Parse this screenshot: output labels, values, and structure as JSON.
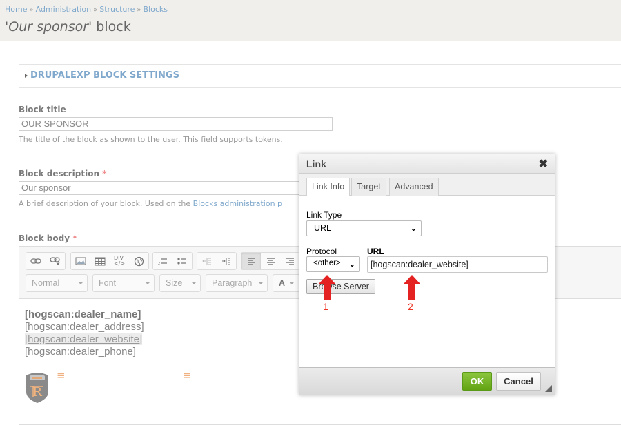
{
  "breadcrumb": [
    {
      "label": "Home"
    },
    {
      "label": "Administration"
    },
    {
      "label": "Structure"
    },
    {
      "label": "Blocks"
    }
  ],
  "breadcrumb_separator": "»",
  "page_title": {
    "prefix": "'",
    "name": "Our sponsor",
    "suffix": "' block"
  },
  "fieldset": {
    "legend": "DRUPALEXP BLOCK SETTINGS"
  },
  "block_title": {
    "label": "Block title",
    "value": "OUR SPONSOR",
    "description": "The title of the block as shown to the user. This field supports tokens."
  },
  "block_description": {
    "label": "Block description",
    "required_marker": "*",
    "value": "Our sponsor",
    "description_prefix": "A brief description of your block. Used on the ",
    "description_link": "Blocks administration p"
  },
  "block_body": {
    "label": "Block body",
    "required_marker": "*",
    "toolbar": {
      "groups": [
        [
          "link-icon",
          "unlink-icon"
        ],
        [
          "image-icon",
          "table-icon",
          "div-icon",
          "iframe-globe-icon"
        ],
        [
          "numbered-list-icon",
          "bulleted-list-icon"
        ],
        [
          "outdent-icon",
          "indent-icon"
        ],
        [
          "align-left-icon",
          "align-center-icon",
          "align-right-icon"
        ]
      ],
      "combos": [
        "Normal",
        "Font",
        "Size",
        "Paragraph"
      ],
      "text_color_label": "A"
    },
    "content": {
      "line1": "[hogscan:dealer_name]",
      "line2": "[hogscan:dealer_address]",
      "line3": "[hogscan:dealer_website]",
      "line4": "[hogscan:dealer_phone]"
    }
  },
  "dialog": {
    "title": "Link",
    "close_glyph": "✖",
    "tabs": [
      {
        "label": "Link Info",
        "active": true
      },
      {
        "label": "Target",
        "active": false
      },
      {
        "label": "Advanced",
        "active": false
      }
    ],
    "link_type_label": "Link Type",
    "link_type_value": "URL",
    "protocol_label": "Protocol",
    "protocol_value": "<other>",
    "url_label": "URL",
    "url_value": "[hogscan:dealer_website]",
    "browse_button": "Browse Server",
    "ok_button": "OK",
    "cancel_button": "Cancel"
  },
  "annotations": [
    {
      "number": "1",
      "target": "protocol"
    },
    {
      "number": "2",
      "target": "url"
    }
  ],
  "colors": {
    "link": "#7fa8cc",
    "required": "#ee8888",
    "ok_green": "#6aab1f",
    "arrow_red": "#e52222"
  }
}
